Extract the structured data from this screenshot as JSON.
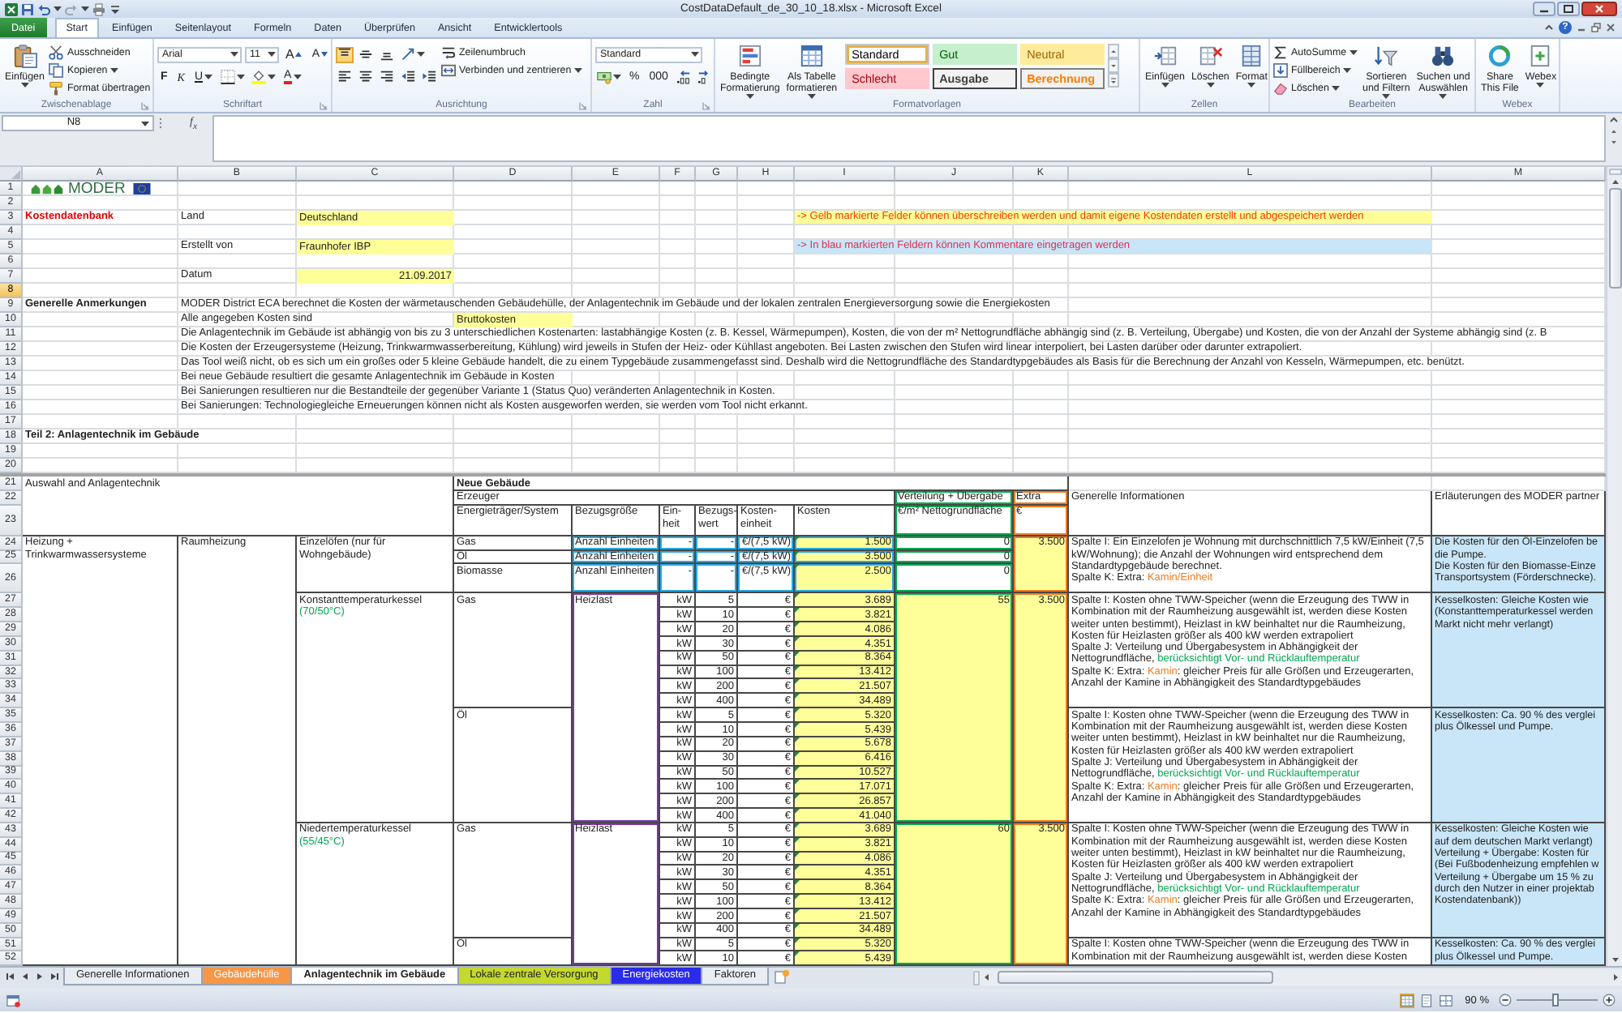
{
  "window": {
    "title": "CostDataDefault_de_30_10_18.xlsx - Microsoft Excel"
  },
  "ribbon": {
    "tabs": [
      {
        "label": "Datei",
        "kind": "file",
        "selected": false
      },
      {
        "label": "Start",
        "kind": "tab",
        "selected": true
      },
      {
        "label": "Einfügen",
        "kind": "tab",
        "selected": false
      },
      {
        "label": "Seitenlayout",
        "kind": "tab",
        "selected": false
      },
      {
        "label": "Formeln",
        "kind": "tab",
        "selected": false
      },
      {
        "label": "Daten",
        "kind": "tab",
        "selected": false
      },
      {
        "label": "Überprüfen",
        "kind": "tab",
        "selected": false
      },
      {
        "label": "Ansicht",
        "kind": "tab",
        "selected": false
      },
      {
        "label": "Entwicklertools",
        "kind": "tab",
        "selected": false
      }
    ],
    "help": "?",
    "groups": [
      {
        "label": "Zwischenablage",
        "launcher": true,
        "parts": [
          {
            "kind": "large",
            "label": "Einfügen"
          },
          {
            "kind": "stack",
            "items": [
              {
                "label": "Ausschneiden"
              },
              {
                "label": "Kopieren"
              },
              {
                "label": "Format übertragen"
              }
            ]
          }
        ]
      },
      {
        "label": "Schriftart",
        "launcher": true,
        "parts": [
          {
            "kind": "lines",
            "lines": [
              [
                {
                  "kind": "field",
                  "label": "Arial"
                },
                {
                  "kind": "field",
                  "label": "11"
                },
                {
                  "kind": "glyph",
                  "label": "A"
                },
                {
                  "kind": "glyph",
                  "label": "A"
                }
              ],
              [
                {
                  "kind": "glyph",
                  "label": "F"
                },
                {
                  "kind": "glyph",
                  "label": "K"
                },
                {
                  "kind": "glyph",
                  "label": "U"
                },
                {
                  "kind": "icon"
                },
                {
                  "kind": "icon"
                },
                {
                  "kind": "glyph",
                  "label": "A"
                }
              ]
            ]
          }
        ]
      },
      {
        "label": "Ausrichtung",
        "launcher": true,
        "parts": [
          {
            "kind": "lines",
            "lines": [
              [
                {
                  "kind": "icon",
                  "selected": true
                },
                {
                  "kind": "icon",
                  "selected": false
                },
                {
                  "kind": "icon",
                  "selected": false
                },
                {
                  "kind": "icon"
                }
              ],
              [
                {
                  "kind": "icon",
                  "selected": false
                },
                {
                  "kind": "icon",
                  "selected": false
                },
                {
                  "kind": "icon",
                  "selected": false
                },
                {
                  "kind": "icon"
                },
                {
                  "kind": "icon"
                }
              ]
            ]
          },
          {
            "kind": "stack",
            "items": [
              {
                "label": "Zeilenumbruch"
              },
              {
                "label": "Verbinden und zentrieren"
              }
            ]
          }
        ]
      },
      {
        "label": "Zahl",
        "launcher": true,
        "parts": [
          {
            "kind": "lines",
            "lines": [
              [
                {
                  "kind": "field",
                  "label": "Standard"
                }
              ],
              [
                {
                  "kind": "icon"
                },
                {
                  "kind": "glyph",
                  "label": "%"
                },
                {
                  "kind": "glyph",
                  "label": "000"
                },
                {
                  "kind": "icon"
                },
                {
                  "kind": "icon"
                }
              ]
            ]
          }
        ]
      },
      {
        "label": "Formatvorlagen",
        "launcher": false,
        "parts": [
          {
            "kind": "large",
            "label": "Bedingte\nFormatierung"
          },
          {
            "kind": "large",
            "label": "Als Tabelle\nformatieren"
          },
          {
            "kind": "gallery",
            "styles": [
              {
                "label": "Standard",
                "kind": "normal",
                "selected": true
              },
              {
                "label": "Gut",
                "kind": "good",
                "selected": false
              },
              {
                "label": "Neutral",
                "kind": "neutral",
                "selected": false
              },
              {
                "label": "Schlecht",
                "kind": "bad",
                "selected": false
              },
              {
                "label": "Ausgabe",
                "kind": "output",
                "selected": false
              },
              {
                "label": "Berechnung",
                "kind": "calculation",
                "selected": false
              }
            ]
          }
        ]
      },
      {
        "label": "Zellen",
        "launcher": false,
        "parts": [
          {
            "kind": "large",
            "label": "Einfügen"
          },
          {
            "kind": "large",
            "label": "Löschen"
          },
          {
            "kind": "large",
            "label": "Format"
          }
        ]
      },
      {
        "label": "Bearbeiten",
        "launcher": false,
        "parts": [
          {
            "kind": "stack",
            "items": [
              {
                "label": "AutoSumme"
              },
              {
                "label": "Füllbereich"
              },
              {
                "label": "Löschen"
              }
            ]
          },
          {
            "kind": "large",
            "label": "Sortieren\nund Filtern"
          },
          {
            "kind": "large",
            "label": "Suchen und\nAuswählen"
          }
        ]
      },
      {
        "label": "Webex",
        "launcher": false,
        "parts": [
          {
            "kind": "large",
            "label": "Share\nThis File"
          },
          {
            "kind": "large",
            "label": "Webex"
          }
        ]
      }
    ]
  },
  "formula_bar": {
    "name_box": "N8",
    "function_label": "f$_{x}$"
  },
  "sheet": {
    "columns": [
      {
        "label": "A",
        "selected": false
      },
      {
        "label": "B",
        "selected": false
      },
      {
        "label": "C",
        "selected": false
      },
      {
        "label": "D",
        "selected": false
      },
      {
        "label": "E",
        "selected": false
      },
      {
        "label": "F",
        "selected": false
      },
      {
        "label": "G",
        "selected": false
      },
      {
        "label": "H",
        "selected": false
      },
      {
        "label": "I",
        "selected": false
      },
      {
        "label": "J",
        "selected": false
      },
      {
        "label": "K",
        "selected": false
      },
      {
        "label": "L",
        "selected": false
      },
      {
        "label": "M",
        "selected": false
      }
    ],
    "rows": [
      {
        "label": "1",
        "selected": false
      },
      {
        "label": "2",
        "selected": false
      },
      {
        "label": "3",
        "selected": false
      },
      {
        "label": "4",
        "selected": false
      },
      {
        "label": "5",
        "selected": false
      },
      {
        "label": "6",
        "selected": false
      },
      {
        "label": "7",
        "selected": false
      },
      {
        "label": "8",
        "selected": true
      },
      {
        "label": "9",
        "selected": false
      },
      {
        "label": "10",
        "selected": false
      },
      {
        "label": "11",
        "selected": false
      },
      {
        "label": "12",
        "selected": false
      },
      {
        "label": "13",
        "selected": false
      },
      {
        "label": "14",
        "selected": false
      },
      {
        "label": "15",
        "selected": false
      },
      {
        "label": "16",
        "selected": false
      },
      {
        "label": "17",
        "selected": false
      },
      {
        "label": "18",
        "selected": false
      },
      {
        "label": "19",
        "selected": false
      },
      {
        "label": "20",
        "selected": false
      },
      {
        "label": "21",
        "selected": false
      },
      {
        "label": "22",
        "selected": false
      },
      {
        "label": "23",
        "selected": false
      },
      {
        "label": "24",
        "selected": false
      },
      {
        "label": "25",
        "selected": false
      },
      {
        "label": "26",
        "selected": false
      },
      {
        "label": "27",
        "selected": false
      },
      {
        "label": "28",
        "selected": false
      },
      {
        "label": "29",
        "selected": false
      },
      {
        "label": "30",
        "selected": false
      },
      {
        "label": "31",
        "selected": false
      },
      {
        "label": "32",
        "selected": false
      },
      {
        "label": "33",
        "selected": false
      },
      {
        "label": "34",
        "selected": false
      },
      {
        "label": "35",
        "selected": false
      },
      {
        "label": "36",
        "selected": false
      },
      {
        "label": "37",
        "selected": false
      },
      {
        "label": "38",
        "selected": false
      },
      {
        "label": "39",
        "selected": false
      },
      {
        "label": "40",
        "selected": false
      },
      {
        "label": "41",
        "selected": false
      },
      {
        "label": "42",
        "selected": false
      },
      {
        "label": "43",
        "selected": false
      },
      {
        "label": "44",
        "selected": false
      },
      {
        "label": "45",
        "selected": false
      },
      {
        "label": "46",
        "selected": false
      },
      {
        "label": "47",
        "selected": false
      },
      {
        "label": "48",
        "selected": false
      },
      {
        "label": "49",
        "selected": false
      },
      {
        "label": "50",
        "selected": false
      },
      {
        "label": "51",
        "selected": false
      },
      {
        "label": "52",
        "selected": false
      }
    ],
    "intro": {
      "logo": "MODER",
      "title": "Kostendatenbank",
      "fields": [
        {
          "label": "Land",
          "value": "Deutschland",
          "kind": "text"
        },
        {
          "label": "Erstellt von",
          "value": "Fraunhofer IBP",
          "kind": "text"
        },
        {
          "label": "Datum",
          "value": "21.09.2017",
          "kind": "date"
        }
      ],
      "legend": [
        {
          "text": "-> Gelb markierte Felder können überschreiben werden und damit eigene Kostendaten erstellt und abgespeichert werden",
          "kind": "editable"
        },
        {
          "text": "-> In blau markierten Feldern können Kommentare eingetragen werden",
          "kind": "comment"
        }
      ],
      "notes_title": "Generelle Anmerkungen",
      "notes": [
        {
          "kind": "text",
          "text": "MODER District ECA berechnet die Kosten der wärmetauschenden Gebäudehülle, der Anlagentechnik im Gebäude und der lokalen zentralen Energieversorgung sowie die Energiekosten"
        },
        {
          "kind": "setting",
          "label": "Alle angegeben Kosten sind",
          "value": "Bruttokosten"
        },
        {
          "kind": "text",
          "text": "Die Anlagentechnik im Gebäude ist abhängig von bis zu 3 unterschiedlichen Kostenarten: lastabhängige Kosten (z. B. Kessel, Wärmepumpen), Kosten, die von der m² Nettogrundfläche abhängig sind (z. B. Verteilung, Übergabe) und Kosten, die von der Anzahl der Systeme abhängig sind (z. B"
        },
        {
          "kind": "text",
          "text": "Die Kosten der Erzeugersysteme (Heizung, Trinkwarmwasserbereitung, Kühlung) wird jeweils in Stufen der Heiz- oder Kühllast angeboten. Bei Lasten zwischen den Stufen wird linear interpoliert, bei Lasten darüber oder darunter extrapoliert."
        },
        {
          "kind": "text",
          "text": "Das Tool weiß nicht, ob es sich um ein großes oder 5 kleine Gebäude handelt, die zu einem Typgebäude zusammengefasst sind. Deshalb wird die Nettogrundfläche des Standardtypgebäudes als Basis für die Berechnung der Anzahl von Kesseln, Wärmepumpen, etc. benützt."
        },
        {
          "kind": "text",
          "text": "Bei neue Gebäude resultiert die gesamte Anlagentechnik im Gebäude in Kosten"
        },
        {
          "kind": "text",
          "text": "Bei Sanierungen resultieren nur die Bestandteile der gegenüber Variante 1 (Status Quo) veränderten Anlagentechnik in Kosten."
        },
        {
          "kind": "text",
          "text": "Bei Sanierungen: Technologiegleiche Erneuerungen können nicht als Kosten ausgeworfen werden, sie werden vom Tool nicht erkannt."
        }
      ],
      "section_title": "Teil 2: Anlagentechnik im Gebäude"
    },
    "table": {
      "title": "Auswahl and Anlagentechnik",
      "scope": "Neue Gebäude",
      "groups": [
        {
          "label": "Erzeuger",
          "kind": "generator"
        },
        {
          "label": "Verteilung + Übergabe",
          "kind": "distribution"
        },
        {
          "label": "Extra",
          "kind": "extra"
        }
      ],
      "columns": [
        {
          "label": "Energieträger/System",
          "kind": "generator"
        },
        {
          "label": "Bezugsgröße",
          "kind": "generator"
        },
        {
          "label": "Ein-heit",
          "kind": "generator"
        },
        {
          "label": "Bezugs-wert",
          "kind": "generator"
        },
        {
          "label": "Kosten-einheit",
          "kind": "generator"
        },
        {
          "label": "Kosten",
          "kind": "generator"
        },
        {
          "label": "€/m² Nettogrundfläche",
          "kind": "distribution"
        },
        {
          "label": "€",
          "kind": "extra"
        }
      ],
      "info_header": "Generelle Informationen",
      "partner_header": "Erläuterungen des MODER partner",
      "systems": [
        {
          "name": "Heizung + Trinkwarmwassersysteme",
          "subsystems": [
            {
              "name": "Raumheizung",
              "generators": [
                {
                  "kind": "per_unit",
                  "name": "Einzelöfen (nur für Wohngebäude)",
                  "extra": "3.500",
                  "carriers": [
                    {
                      "name": "Gas",
                      "basis": "Anzahl Einheiten",
                      "unit": "-",
                      "ref_value": "-",
                      "cost_unit": "€/(7,5 kW)",
                      "cost": "1.500",
                      "error_marker": true,
                      "distribution": "0"
                    },
                    {
                      "name": "Öl",
                      "basis": "Anzahl Einheiten",
                      "unit": "-",
                      "ref_value": "-",
                      "cost_unit": "€/(7,5 kW)",
                      "cost": "3.500",
                      "error_marker": true,
                      "distribution": "0"
                    },
                    {
                      "name": "Biomasse",
                      "basis": "Anzahl Einheiten",
                      "unit": "-",
                      "ref_value": "-",
                      "cost_unit": "€/(7,5 kW)",
                      "cost": "2.500",
                      "error_marker": true,
                      "distribution": "0"
                    }
                  ],
                  "info": [
                    [
                      {
                        "text": "Spalte I: Ein Einzelofen je Wohnung mit durchschnittlich 7,5 kW/Einheit (7,5 kW/Wohnung); die Anzahl der Wohnungen wird entsprechend dem Standardtypgebäude berechnet.",
                        "kind": "plain"
                      }
                    ],
                    [
                      {
                        "text": "Spalte K: Extra: ",
                        "kind": "plain"
                      },
                      {
                        "text": "Kamin/Einheit",
                        "kind": "extra"
                      }
                    ]
                  ],
                  "partner": [
                    "Die Kosten für den Öl-Einzelofen be",
                    "die Pumpe.",
                    "Die Kosten für den Biomasse-Einze",
                    "Transportsystem (Förderschnecke)."
                  ]
                },
                {
                  "kind": "load_steps",
                  "name": "Konstanttemperaturkessel",
                  "note": "(70/50°C)",
                  "basis": "Heizlast",
                  "distribution": "55",
                  "extra": "3.500",
                  "carriers": [
                    {
                      "name": "Gas",
                      "steps": [
                        {
                          "unit": "kW",
                          "value": "5",
                          "currency": "€",
                          "cost": "3.689",
                          "error_marker": true
                        },
                        {
                          "unit": "kW",
                          "value": "10",
                          "currency": "€",
                          "cost": "3.821",
                          "error_marker": true
                        },
                        {
                          "unit": "kW",
                          "value": "20",
                          "currency": "€",
                          "cost": "4.086",
                          "error_marker": true
                        },
                        {
                          "unit": "kW",
                          "value": "30",
                          "currency": "€",
                          "cost": "4.351",
                          "error_marker": true
                        },
                        {
                          "unit": "kW",
                          "value": "50",
                          "currency": "€",
                          "cost": "8.364",
                          "error_marker": true
                        },
                        {
                          "unit": "kW",
                          "value": "100",
                          "currency": "€",
                          "cost": "13.412",
                          "error_marker": true
                        },
                        {
                          "unit": "kW",
                          "value": "200",
                          "currency": "€",
                          "cost": "21.507",
                          "error_marker": true
                        },
                        {
                          "unit": "kW",
                          "value": "400",
                          "currency": "€",
                          "cost": "34.489",
                          "error_marker": true
                        }
                      ],
                      "info": [
                        [
                          {
                            "text": "Spalte I: Kosten ohne TWW-Speicher (wenn die Erzeugung des TWW in Kombination mit der Raumheizung ausgewählt ist, werden diese Kosten weiter unten bestimmt), Heizlast in kW beinhaltet nur die Raumheizung, Kosten für Heizlasten größer als 400 kW werden extrapoliert",
                            "kind": "plain"
                          }
                        ],
                        [
                          {
                            "text": "Spalte J: Verteilung und Übergabesystem in Abhängigkeit der Nettogrundfläche, ",
                            "kind": "plain"
                          },
                          {
                            "text": "berücksichtigt Vor- und Rücklauftemperatur",
                            "kind": "temperature"
                          }
                        ],
                        [
                          {
                            "text": "Spalte K: Extra: ",
                            "kind": "plain"
                          },
                          {
                            "text": "Kamin",
                            "kind": "extra"
                          },
                          {
                            "text": ": gleicher Preis für alle Größen und Erzeugerarten, Anzahl der Kamine in Abhängigkeit des Standardtypgebäudes",
                            "kind": "plain"
                          }
                        ]
                      ],
                      "partner": [
                        "Kesselkosten: Gleiche Kosten wie",
                        "(Konstanttemperaturkessel werden",
                        "Markt nicht mehr verlangt)"
                      ]
                    },
                    {
                      "name": "Öl",
                      "steps": [
                        {
                          "unit": "kW",
                          "value": "5",
                          "currency": "€",
                          "cost": "5.320",
                          "error_marker": true
                        },
                        {
                          "unit": "kW",
                          "value": "10",
                          "currency": "€",
                          "cost": "5.439",
                          "error_marker": true
                        },
                        {
                          "unit": "kW",
                          "value": "20",
                          "currency": "€",
                          "cost": "5.678",
                          "error_marker": true
                        },
                        {
                          "unit": "kW",
                          "value": "30",
                          "currency": "€",
                          "cost": "6.416",
                          "error_marker": true
                        },
                        {
                          "unit": "kW",
                          "value": "50",
                          "currency": "€",
                          "cost": "10.527",
                          "error_marker": true
                        },
                        {
                          "unit": "kW",
                          "value": "100",
                          "currency": "€",
                          "cost": "17.071",
                          "error_marker": true
                        },
                        {
                          "unit": "kW",
                          "value": "200",
                          "currency": "€",
                          "cost": "26.857",
                          "error_marker": true
                        },
                        {
                          "unit": "kW",
                          "value": "400",
                          "currency": "€",
                          "cost": "41.040",
                          "error_marker": true
                        }
                      ],
                      "info": [
                        [
                          {
                            "text": "Spalte I: Kosten ohne TWW-Speicher (wenn die Erzeugung des TWW in Kombination mit der Raumheizung ausgewählt ist, werden diese Kosten weiter unten bestimmt), Heizlast in kW beinhaltet nur die Raumheizung, Kosten für Heizlasten größer als 400 kW werden extrapoliert",
                            "kind": "plain"
                          }
                        ],
                        [
                          {
                            "text": "Spalte J: Verteilung und Übergabesystem in Abhängigkeit der Nettogrundfläche, ",
                            "kind": "plain"
                          },
                          {
                            "text": "berücksichtigt Vor- und Rücklauftemperatur",
                            "kind": "temperature"
                          }
                        ],
                        [
                          {
                            "text": "Spalte K: Extra: ",
                            "kind": "plain"
                          },
                          {
                            "text": "Kamin",
                            "kind": "extra"
                          },
                          {
                            "text": ": gleicher Preis für alle Größen und Erzeugerarten, Anzahl der Kamine in Abhängigkeit des Standardtypgebäudes",
                            "kind": "plain"
                          }
                        ]
                      ],
                      "partner": [
                        "Kesselkosten: Ca. 90 % des verglei",
                        "plus Ölkessel und Pumpe."
                      ]
                    }
                  ]
                },
                {
                  "kind": "load_steps",
                  "name": "Niedertemperaturkessel",
                  "note": "(55/45°C)",
                  "basis": "Heizlast",
                  "distribution": "60",
                  "extra": "3.500",
                  "carriers": [
                    {
                      "name": "Gas",
                      "steps": [
                        {
                          "unit": "kW",
                          "value": "5",
                          "currency": "€",
                          "cost": "3.689",
                          "error_marker": true
                        },
                        {
                          "unit": "kW",
                          "value": "10",
                          "currency": "€",
                          "cost": "3.821",
                          "error_marker": true
                        },
                        {
                          "unit": "kW",
                          "value": "20",
                          "currency": "€",
                          "cost": "4.086",
                          "error_marker": true
                        },
                        {
                          "unit": "kW",
                          "value": "30",
                          "currency": "€",
                          "cost": "4.351",
                          "error_marker": true
                        },
                        {
                          "unit": "kW",
                          "value": "50",
                          "currency": "€",
                          "cost": "8.364",
                          "error_marker": true
                        },
                        {
                          "unit": "kW",
                          "value": "100",
                          "currency": "€",
                          "cost": "13.412",
                          "error_marker": true
                        },
                        {
                          "unit": "kW",
                          "value": "200",
                          "currency": "€",
                          "cost": "21.507",
                          "error_marker": true
                        },
                        {
                          "unit": "kW",
                          "value": "400",
                          "currency": "€",
                          "cost": "34.489",
                          "error_marker": true
                        }
                      ],
                      "info": [
                        [
                          {
                            "text": "Spalte I: Kosten ohne TWW-Speicher (wenn die Erzeugung des TWW in Kombination mit der Raumheizung ausgewählt ist, werden diese Kosten weiter unten bestimmt), Heizlast in kW beinhaltet nur die Raumheizung, Kosten für Heizlasten größer als 400 kW werden extrapoliert",
                            "kind": "plain"
                          }
                        ],
                        [
                          {
                            "text": "Spalte J: Verteilung und Übergabesystem in Abhängigkeit der Nettogrundfläche, ",
                            "kind": "plain"
                          },
                          {
                            "text": "berücksichtigt Vor- und Rücklauftemperatur",
                            "kind": "temperature"
                          }
                        ],
                        [
                          {
                            "text": "Spalte K: Extra: ",
                            "kind": "plain"
                          },
                          {
                            "text": "Kamin",
                            "kind": "extra"
                          },
                          {
                            "text": ": gleicher Preis für alle Größen und Erzeugerarten, Anzahl der Kamine in Abhängigkeit des Standardtypgebäudes",
                            "kind": "plain"
                          }
                        ]
                      ],
                      "partner": [
                        "Kesselkosten: Gleiche Kosten wie",
                        "auf dem deutschen Markt verlangt)",
                        "Verteilung + Übergabe: Kosten für",
                        "(Bei Fußbodenheizung empfehlen w",
                        "Verteilung + Übergabe um 15 % zu",
                        "durch den Nutzer in einer projektab",
                        "Kostendatenbank))"
                      ]
                    },
                    {
                      "name": "Öl",
                      "steps": [
                        {
                          "unit": "kW",
                          "value": "5",
                          "currency": "€",
                          "cost": "5.320",
                          "error_marker": true
                        },
                        {
                          "unit": "kW",
                          "value": "10",
                          "currency": "€",
                          "cost": "5.439",
                          "error_marker": true
                        }
                      ],
                      "info": [
                        [
                          {
                            "text": "Spalte I: Kosten ohne TWW-Speicher (wenn die Erzeugung des TWW in Kombination mit der Raumheizung ausgewählt ist, werden diese Kosten",
                            "kind": "plain"
                          }
                        ]
                      ],
                      "partner": [
                        "Kesselkosten: Ca. 90 % des verglei",
                        "plus Ölkessel und Pumpe."
                      ]
                    }
                  ]
                }
              ]
            }
          ]
        }
      ]
    }
  },
  "sheet_tabs": [
    {
      "label": "Generelle Informationen",
      "selected": false
    },
    {
      "label": "Gebäudehülle",
      "selected": false,
      "color": "#f79646"
    },
    {
      "label": "Anlagentechnik im Gebäude",
      "selected": true
    },
    {
      "label": "Lokale zentrale Versorgung",
      "selected": false,
      "color": "#c4d82e"
    },
    {
      "label": "Energiekosten",
      "selected": false,
      "color": "#2b2bea"
    },
    {
      "label": "Faktoren",
      "selected": false
    }
  ],
  "status_bar": {
    "views": [
      {
        "selected": true
      },
      {
        "selected": false
      },
      {
        "selected": false
      }
    ],
    "zoom": "90 %",
    "zoom_slider": {
      "level": 0.48
    }
  }
}
